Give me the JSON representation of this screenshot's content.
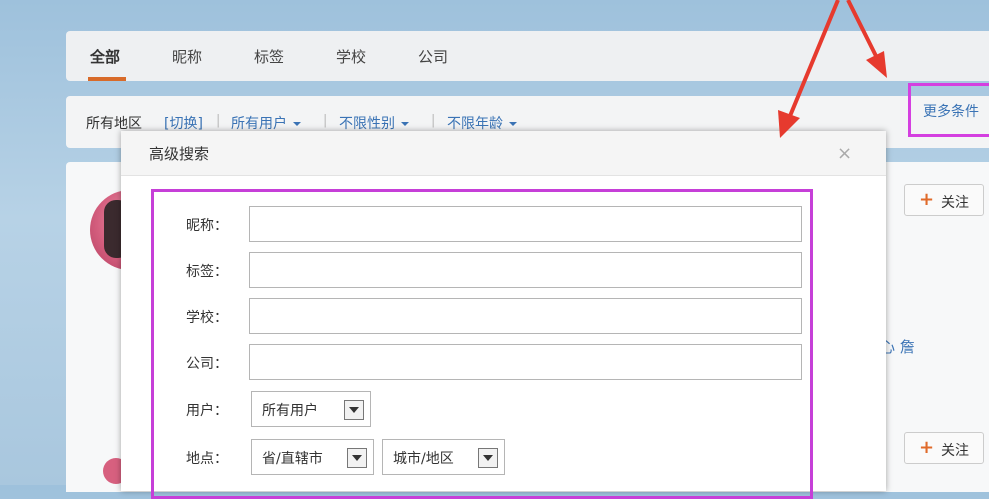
{
  "tabs": [
    {
      "label": "全部",
      "active": true
    },
    {
      "label": "昵称",
      "active": false
    },
    {
      "label": "标签",
      "active": false
    },
    {
      "label": "学校",
      "active": false
    },
    {
      "label": "公司",
      "active": false
    }
  ],
  "filters": {
    "region_label": "所有地区",
    "switch_link": "[切换]",
    "users_dropdown": "所有用户",
    "gender_dropdown": "不限性别",
    "age_dropdown": "不限年龄",
    "separator": "|",
    "more_conditions": "更多条件"
  },
  "list": {
    "follow_label": "关注",
    "follow_plus": "+",
    "partial_text": "心 詹"
  },
  "dialog": {
    "title": "高级搜索",
    "close": "×",
    "fields": {
      "nickname": {
        "label": "昵称：",
        "value": ""
      },
      "tag": {
        "label": "标签：",
        "value": ""
      },
      "school": {
        "label": "学校：",
        "value": ""
      },
      "company": {
        "label": "公司：",
        "value": ""
      }
    },
    "user_select": {
      "label": "用户：",
      "value": "所有用户"
    },
    "location": {
      "label": "地点：",
      "province_value": "省/直辖市",
      "city_value": "城市/地区"
    }
  },
  "colors": {
    "highlight_border": "#d43fe0",
    "arrow": "#e63a2e",
    "link": "#3a73b5",
    "active_tab_underline": "#d86b2a"
  }
}
